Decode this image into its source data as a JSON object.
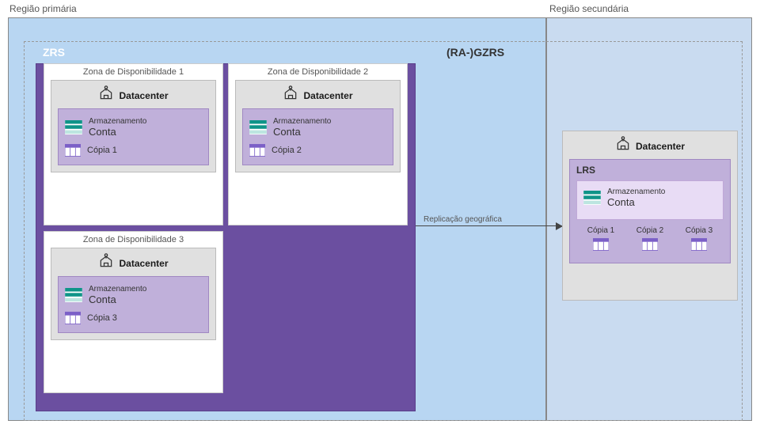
{
  "regions": {
    "primary": "Região primária",
    "secondary": "Região secundária"
  },
  "gzrs": "(RA-)GZRS",
  "zrs": "ZRS",
  "lrs": "LRS",
  "datacenter": "Datacenter",
  "storage": {
    "line1": "Armazenamento",
    "line2": "Conta"
  },
  "zones": [
    {
      "title": "Zona de Disponibilidade 1",
      "copy": "Cópia 1"
    },
    {
      "title": "Zona de Disponibilidade 2",
      "copy": "Cópia 2"
    },
    {
      "title": "Zona de Disponibilidade 3",
      "copy": "Cópia 3"
    }
  ],
  "replication": "Replicação geográfica",
  "secondary_copies": [
    "Cópia 1",
    "Cópia 2",
    "Cópia 3"
  ]
}
